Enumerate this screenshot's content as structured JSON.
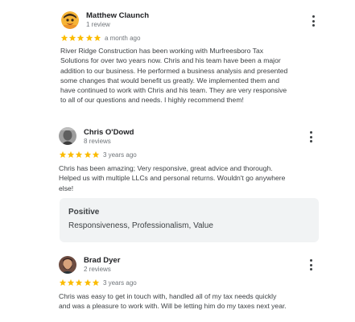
{
  "reviews": [
    {
      "author": "Matthew Claunch",
      "review_count": "1 review",
      "rating": 5,
      "time": "a month ago",
      "avatar_icon": "emoji-face-avatar",
      "text_lines": [
        "River Ridge Construction has been working with Murfreesboro Tax",
        "Solutions for over two years now. Chris and his team have been a major",
        "addition to our business. He performed a business analysis and presented",
        "some changes that would benefit us greatly. We implemented them and",
        "have continued to work with Chris and his team. They are very responsive",
        "to all of our questions and needs. I highly recommend them!"
      ]
    },
    {
      "author": "Chris O'Dowd",
      "review_count": "8 reviews",
      "rating": 5,
      "time": "3 years ago",
      "avatar_icon": "grayscale-photo-avatar",
      "text_lines": [
        "Chris has been amazing; Very responsive, great advice and thorough.",
        "Helped us with multiple LLCs and personal returns. Wouldn't go anywhere",
        "else!"
      ],
      "highlight": {
        "title": "Positive",
        "body": "Responsiveness, Professionalism, Value"
      }
    },
    {
      "author": "Brad Dyer",
      "review_count": "2 reviews",
      "rating": 5,
      "time": "3 years ago",
      "avatar_icon": "bearded-man-photo-avatar",
      "text_lines": [
        "Chris was easy to get in touch with, handled all of my tax needs quickly",
        "and was a pleasure to work with. Will be letting him do my taxes next year."
      ]
    }
  ],
  "colors": {
    "star": "#fbbc04",
    "name": "#202124",
    "text": "#3c4043",
    "meta": "#70757a",
    "highlight_bg": "#f1f3f4"
  }
}
